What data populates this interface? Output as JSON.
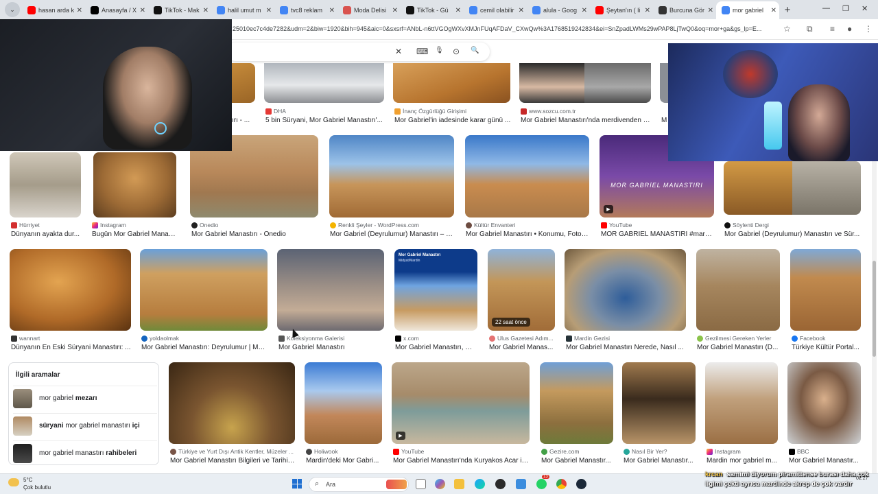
{
  "tabs": [
    {
      "label": "hasan arda k",
      "icon": "youtube-icon",
      "color": "#ff0000"
    },
    {
      "label": "Anasayfa / X",
      "icon": "x-icon",
      "color": "#000000"
    },
    {
      "label": "TikTok - Mak",
      "icon": "tiktok-icon",
      "color": "#111111"
    },
    {
      "label": "halil umut m",
      "icon": "google-icon",
      "color": "#4285f4"
    },
    {
      "label": "tvc8 reklam",
      "icon": "google-icon",
      "color": "#4285f4"
    },
    {
      "label": "Moda Delisi",
      "icon": "moda-icon",
      "color": "#d9534f"
    },
    {
      "label": "TikTok - Gü",
      "icon": "tiktok-icon",
      "color": "#111111"
    },
    {
      "label": "cemil olabilir",
      "icon": "google-icon",
      "color": "#4285f4"
    },
    {
      "label": "alula - Goog",
      "icon": "google-icon",
      "color": "#4285f4"
    },
    {
      "label": "Şeytan'ın ( li",
      "icon": "youtube-icon",
      "color": "#ff0000"
    },
    {
      "label": "Burcuna Gör",
      "icon": "burcuna-icon",
      "color": "#333333"
    },
    {
      "label": "mor gabriel",
      "icon": "google-icon",
      "color": "#4285f4",
      "active": true
    }
  ],
  "newtab_label": "+",
  "window_controls": {
    "minimize": "—",
    "restore": "❐",
    "close": "✕"
  },
  "url": "25010ec7c4de7282&udm=2&biw=1920&bih=945&aic=0&sxsrf=ANbL-n6ttVGOgWXvXMJnFUqAFDaV_CXwQw%3A1768519242834&ei=SnZpadLWMs29wPAP8LjTwQ0&oq=mor+ga&gs_lp=E...",
  "search": {
    "clear": "✕",
    "keyboard": "⌨",
    "mic": "🎤",
    "lens": "⊙",
    "submit": "🔍"
  },
  "top_row": [
    {
      "source": "DHA",
      "caption": "5 bin Süryani, Mor Gabriel Manastırı'..."
    },
    {
      "source": "İnanç Özgürlüğü Girişimi",
      "caption": "Mor Gabriel'in iadesinde karar günü ..."
    },
    {
      "source": "www.sozcu.com.tr",
      "caption": "Mor Gabriel Manastırı'nda merdivenden d..."
    }
  ],
  "top_row_partial_left": "ırı - ...",
  "top_row_partial_right": "M",
  "row1": [
    {
      "source": "Hürriyet",
      "caption": "Dünyanın ayakta dur..."
    },
    {
      "source": "Instagram",
      "caption": "Bugün Mor Gabriel Manast..."
    },
    {
      "source": "Onedio",
      "caption": "Mor Gabriel Manastırı - Onedio"
    },
    {
      "source": "Renkli Şeyler - WordPress.com",
      "caption": "Mor Gabriel (Deyrulumur) Manastırı – R..."
    },
    {
      "source": "Kültür Envanteri",
      "caption": "Mor Gabriel Manastırı • Konumu, Fotoğ..."
    },
    {
      "source": "YouTube",
      "caption": "MOR GABRİEL MANASTIRI #mard..."
    },
    {
      "source": "Söylenti Dergi",
      "caption": "Mor Gabriel (Deyrulumur) Manastırı ve Sür..."
    }
  ],
  "row1_overlay_text": "MOR GABRİEL MANASTIRI",
  "row2": [
    {
      "source": "wannart",
      "caption": "Dünyanın En Eski Süryani Manastırı: ..."
    },
    {
      "source": "yoldaolmak",
      "caption": "Mor Gabriel Manastırı: Deyrulumur | Ma..."
    },
    {
      "source": "Koleksiyonma Galerisi",
      "caption": "Mor Gabriel Manastırı"
    },
    {
      "source": "x.com",
      "caption": "Mor Gabriel Manastırı, Mi..."
    },
    {
      "source": "Ulus Gazetesi Adım...",
      "caption": "Mor Gabriel Manas..."
    },
    {
      "source": "Mardin Gezisi",
      "caption": "Mor Gabriel Manastırı Nerede, Nasıl ..."
    },
    {
      "source": "Gezilmesi Gereken Yerler",
      "caption": "Mor Gabriel Manastırı (D..."
    },
    {
      "source": "Facebook",
      "caption": "Türkiye Kültür Portal..."
    }
  ],
  "row2_post_title": "Mor Gabriel Manastırı",
  "row2_post_sub": "Midyat/Mardin",
  "row2_badge": "22 saat önce",
  "related": {
    "title": "İlgili aramalar",
    "items": [
      {
        "plain": "mor gabriel ",
        "bold": "mezarı",
        "suffix": ""
      },
      {
        "plain": "",
        "bold": "süryani",
        "suffix": " mor gabriel manastırı ",
        "bold2": "içi"
      },
      {
        "plain": "mor gabriel manastırı ",
        "bold": "rahibeleri",
        "suffix": ""
      }
    ]
  },
  "row3": [
    {
      "source": "Türkiye ve Yurt Dışı Antik Kentler, Müzeler ...",
      "caption": "Mor Gabriel Manastırı Bilgileri ve Tarihi (..."
    },
    {
      "source": "Holiwook",
      "caption": "Mardin'deki Mor Gabri..."
    },
    {
      "source": "YouTube",
      "caption": "Mor Gabriel Manastırı'nda Kuryakos Acar ile..."
    },
    {
      "source": "Gezire.com",
      "caption": "Mor Gabriel Manastır..."
    },
    {
      "source": "Nasıl Bir Yer?",
      "caption": "Mor Gabriel Manastır..."
    },
    {
      "source": "Instagram",
      "caption": "Mardin mor gabriel m..."
    },
    {
      "source": "BBC",
      "caption": "Mor Gabriel Manastır..."
    }
  ],
  "taskbar": {
    "temp": "5°C",
    "weather": "Çok bulutlu",
    "search_label": "Ara",
    "notification_count": "13",
    "clock": "02:27"
  },
  "chat": {
    "user": "krcan",
    "message": "samimi diyorum piramittense burası daha çok ilgimi çekti ayrıca mardinde akrep de çok vardır"
  }
}
